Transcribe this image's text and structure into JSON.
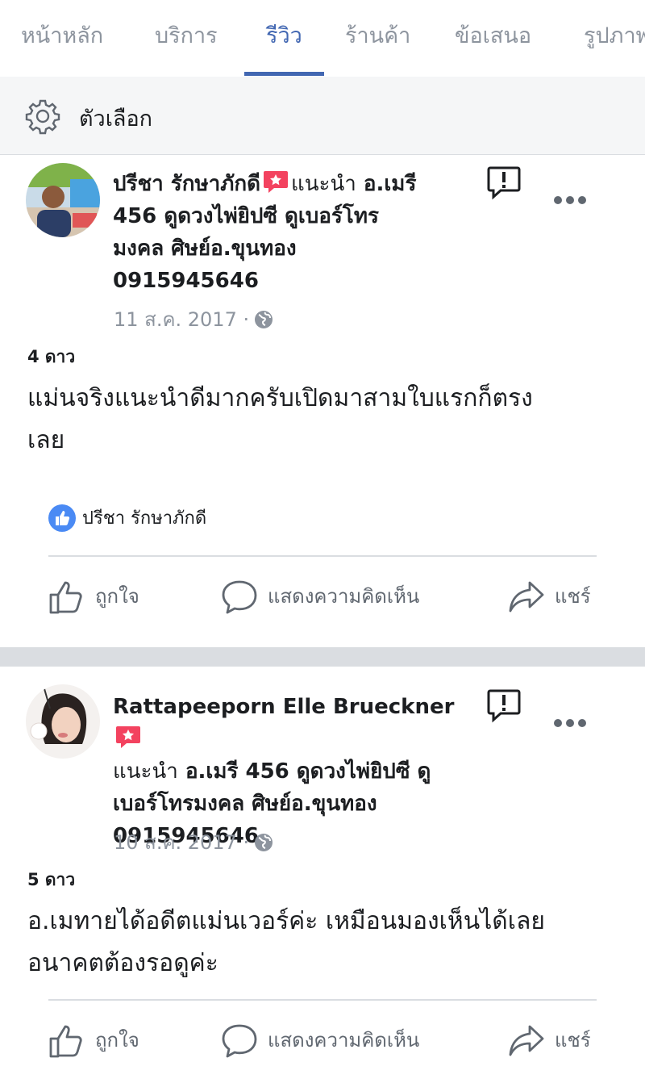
{
  "tabs": [
    {
      "label": "หน้าหลัก"
    },
    {
      "label": "บริการ"
    },
    {
      "label": "รีวิว",
      "active": true
    },
    {
      "label": "ร้านค้า"
    },
    {
      "label": "ข้อเสนอ"
    },
    {
      "label": "รูปภาพ"
    }
  ],
  "options": {
    "label": "ตัวเลือก",
    "icon": "gear-icon"
  },
  "colors": {
    "accent": "#4267b2",
    "badge": "#f3425f",
    "muted": "#8d949e",
    "separator": "#dadde1"
  },
  "reviews": [
    {
      "reviewer": "ปรีชา รักษาภักดี",
      "recommend_word": "แนะนำ",
      "page_name": "อ.เมรี 456 ดูดวงไพ่ยิปซี ดูเบอร์โทรมงคล ศิษย์อ.ขุนทอง 0915945646",
      "page_line1": "อ.เมรี",
      "page_line2": "456 ดูดวงไพ่ยิปซี ดูเบอร์โทร",
      "page_line3": "มงคล ศิษย์อ.ขุนทอง",
      "page_line4": "0915945646",
      "date": "11 ส.ค. 2017 ·",
      "rating": "4 ดาว",
      "text": "แม่นจริงแนะนำดีมากครับเปิดมาสามใบแรกก็ตรงเลย",
      "text_line1": "แม่นจริงแนะนำดีมากครับเปิดมาสามใบแรกก็ตรง",
      "text_line2": "เลย",
      "liked_by": "ปรีชา รักษาภักดี"
    },
    {
      "reviewer": "Rattapeeporn Elle Brueckner",
      "recommend_word": "แนะนำ",
      "page_name": "อ.เมรี 456 ดูดวงไพ่ยิปซี ดูเบอร์โทรมงคล ศิษย์อ.ขุนทอง 0915945646",
      "page_line1": "อ.เมรี 456 ดูดวงไพ่ยิปซี ดู",
      "page_line2": "เบอร์โทรมงคล ศิษย์อ.ขุนทอง",
      "page_line3": "0915945646",
      "date": "10 ส.ค. 2017 ·",
      "rating": "5 ดาว",
      "text": "อ.เมทายได้อดีตแม่นเวอร์ค่ะ เหมือนมองเห็นได้เลย อนาคตต้องรอดูค่ะ",
      "text_line1": "อ.เมทายได้อดีตแม่นเวอร์ค่ะ เหมือนมองเห็นได้เลย",
      "text_line2": "อนาคตต้องรอดูค่ะ"
    }
  ],
  "actions": {
    "like": "ถูกใจ",
    "comment": "แสดงความคิดเห็น",
    "share": "แชร์"
  }
}
